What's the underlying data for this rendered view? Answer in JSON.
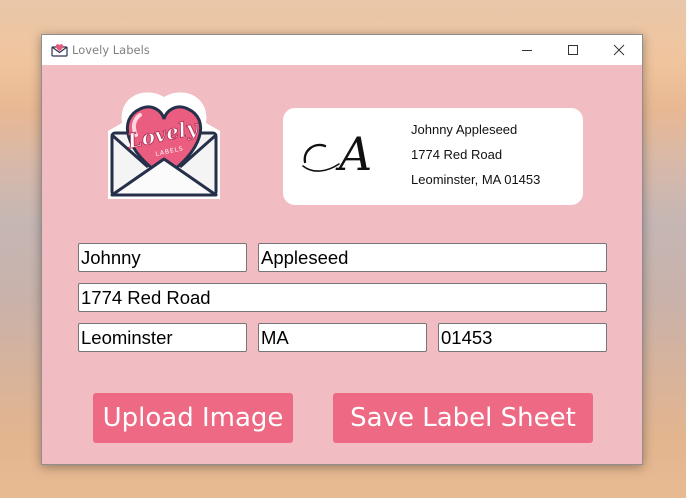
{
  "window": {
    "title": "Lovely Labels",
    "controls": {
      "minimize": "minimize-icon",
      "maximize": "maximize-icon",
      "close": "close-icon"
    }
  },
  "logo": {
    "text_main": "Lovely",
    "text_sub": "LABELS"
  },
  "preview": {
    "monogram": "A",
    "lines": [
      "Johnny Appleseed",
      "1774 Red Road",
      "Leominster, MA 01453"
    ]
  },
  "form": {
    "first_name": "Johnny",
    "last_name": "Appleseed",
    "street": "1774 Red Road",
    "city": "Leominster",
    "state": "MA",
    "zip": "01453"
  },
  "buttons": {
    "upload": "Upload Image",
    "save": "Save Label Sheet"
  },
  "colors": {
    "window_bg": "#f1bdc2",
    "button_bg": "#ee6a84",
    "button_text": "#ffffff"
  }
}
